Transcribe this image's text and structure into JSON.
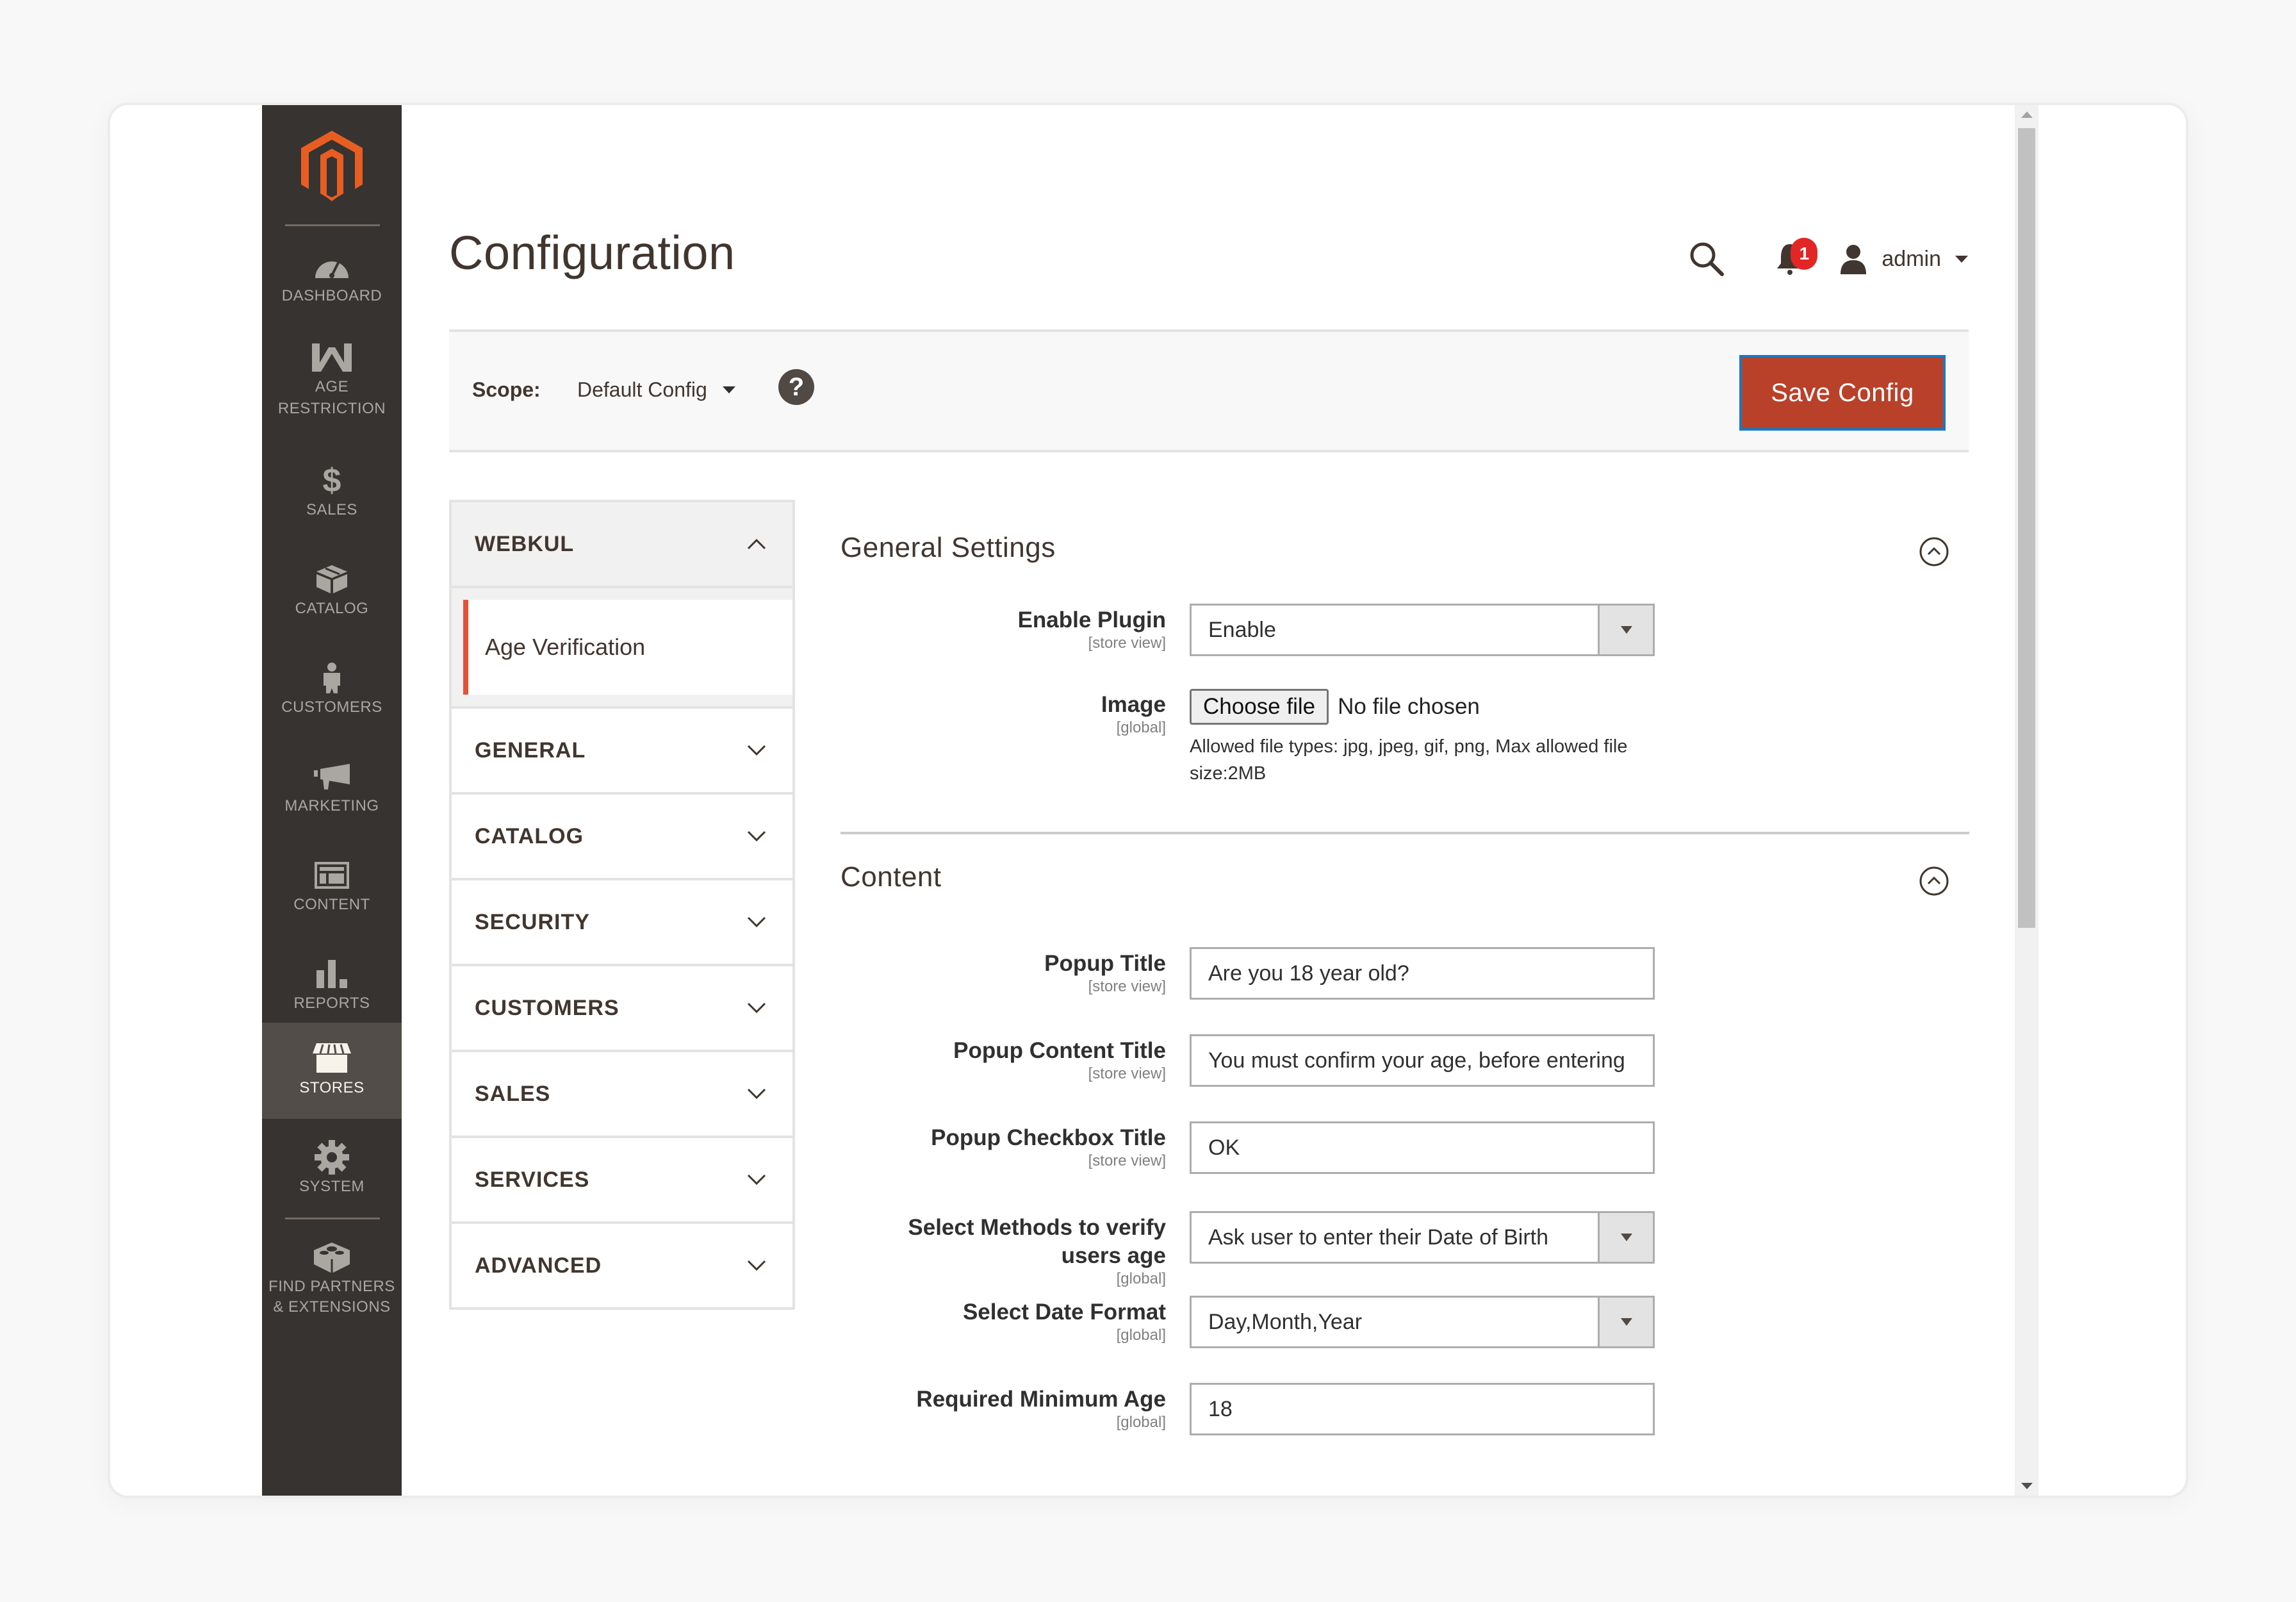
{
  "nav": {
    "items": [
      {
        "label": "Dashboard",
        "icon": "dashboard-gauge-icon",
        "active": false
      },
      {
        "label": "Age Restriction",
        "icon": "webkul-w-icon",
        "active": false
      },
      {
        "label": "Sales",
        "icon": "dollar-icon",
        "active": false
      },
      {
        "label": "Catalog",
        "icon": "box-icon",
        "active": false
      },
      {
        "label": "Customers",
        "icon": "person-icon",
        "active": false
      },
      {
        "label": "Marketing",
        "icon": "megaphone-icon",
        "active": false
      },
      {
        "label": "Content",
        "icon": "layout-icon",
        "active": false
      },
      {
        "label": "Reports",
        "icon": "bar-chart-icon",
        "active": false
      },
      {
        "label": "Stores",
        "icon": "storefront-icon",
        "active": true
      },
      {
        "label": "System",
        "icon": "gear-icon",
        "active": false
      }
    ],
    "extensions": {
      "line1": "Find Partners",
      "line2": "& Extensions",
      "icon": "lego-brick-icon"
    }
  },
  "header": {
    "title": "Configuration",
    "notifications_count": "1",
    "user": "admin"
  },
  "scope": {
    "label": "Scope:",
    "value": "Default Config",
    "help": "?"
  },
  "toolbar": {
    "save_label": "Save Config"
  },
  "tabs": {
    "active_group": {
      "label": "WEBKUL",
      "expanded": true,
      "items": [
        {
          "label": "Age Verification",
          "active": true
        }
      ]
    },
    "groups": [
      {
        "label": "GENERAL"
      },
      {
        "label": "CATALOG"
      },
      {
        "label": "SECURITY"
      },
      {
        "label": "CUSTOMERS"
      },
      {
        "label": "SALES"
      },
      {
        "label": "SERVICES"
      },
      {
        "label": "ADVANCED"
      }
    ]
  },
  "sections": {
    "general": {
      "title": "General Settings",
      "fields": {
        "enable_plugin": {
          "label": "Enable Plugin",
          "scope": "[store view]",
          "value": "Enable"
        },
        "image": {
          "label": "Image",
          "scope": "[global]",
          "button": "Choose file",
          "status": "No file chosen",
          "note": "Allowed file types: jpg, jpeg, gif, png, Max allowed file size:2MB"
        }
      }
    },
    "content": {
      "title": "Content",
      "fields": {
        "popup_title": {
          "label": "Popup Title",
          "scope": "[store view]",
          "value": "Are you 18 year old?"
        },
        "popup_content_title": {
          "label": "Popup Content Title",
          "scope": "[store view]",
          "value": "You must confirm your age, before entering"
        },
        "popup_checkbox_title": {
          "label": "Popup Checkbox Title",
          "scope": "[store view]",
          "value": "OK"
        },
        "verify_method": {
          "label": "Select Methods to verify users age",
          "scope": "[global]",
          "value": "Ask user to enter their Date of Birth"
        },
        "date_format": {
          "label": "Select Date Format",
          "scope": "[global]",
          "value": "Day,Month,Year"
        },
        "min_age": {
          "label": "Required Minimum Age",
          "scope": "[global]",
          "value": "18"
        }
      }
    }
  },
  "colors": {
    "nav_bg": "#373330",
    "nav_active": "#524d49",
    "brand_orange": "#e85d22",
    "save_button": "#b9412a",
    "badge": "#e22626",
    "tab_active_border": "#e55137"
  }
}
